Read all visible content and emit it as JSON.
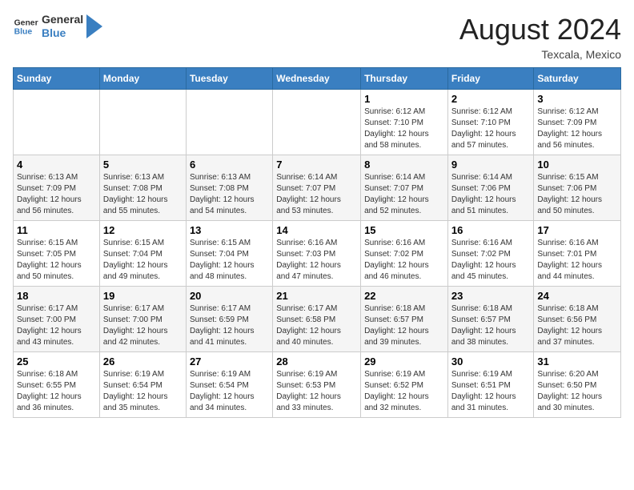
{
  "header": {
    "logo_line1": "General",
    "logo_line2": "Blue",
    "month_year": "August 2024",
    "location": "Texcala, Mexico"
  },
  "days_of_week": [
    "Sunday",
    "Monday",
    "Tuesday",
    "Wednesday",
    "Thursday",
    "Friday",
    "Saturday"
  ],
  "weeks": [
    [
      {
        "day": "",
        "info": ""
      },
      {
        "day": "",
        "info": ""
      },
      {
        "day": "",
        "info": ""
      },
      {
        "day": "",
        "info": ""
      },
      {
        "day": "1",
        "info": "Sunrise: 6:12 AM\nSunset: 7:10 PM\nDaylight: 12 hours\nand 58 minutes."
      },
      {
        "day": "2",
        "info": "Sunrise: 6:12 AM\nSunset: 7:10 PM\nDaylight: 12 hours\nand 57 minutes."
      },
      {
        "day": "3",
        "info": "Sunrise: 6:12 AM\nSunset: 7:09 PM\nDaylight: 12 hours\nand 56 minutes."
      }
    ],
    [
      {
        "day": "4",
        "info": "Sunrise: 6:13 AM\nSunset: 7:09 PM\nDaylight: 12 hours\nand 56 minutes."
      },
      {
        "day": "5",
        "info": "Sunrise: 6:13 AM\nSunset: 7:08 PM\nDaylight: 12 hours\nand 55 minutes."
      },
      {
        "day": "6",
        "info": "Sunrise: 6:13 AM\nSunset: 7:08 PM\nDaylight: 12 hours\nand 54 minutes."
      },
      {
        "day": "7",
        "info": "Sunrise: 6:14 AM\nSunset: 7:07 PM\nDaylight: 12 hours\nand 53 minutes."
      },
      {
        "day": "8",
        "info": "Sunrise: 6:14 AM\nSunset: 7:07 PM\nDaylight: 12 hours\nand 52 minutes."
      },
      {
        "day": "9",
        "info": "Sunrise: 6:14 AM\nSunset: 7:06 PM\nDaylight: 12 hours\nand 51 minutes."
      },
      {
        "day": "10",
        "info": "Sunrise: 6:15 AM\nSunset: 7:06 PM\nDaylight: 12 hours\nand 50 minutes."
      }
    ],
    [
      {
        "day": "11",
        "info": "Sunrise: 6:15 AM\nSunset: 7:05 PM\nDaylight: 12 hours\nand 50 minutes."
      },
      {
        "day": "12",
        "info": "Sunrise: 6:15 AM\nSunset: 7:04 PM\nDaylight: 12 hours\nand 49 minutes."
      },
      {
        "day": "13",
        "info": "Sunrise: 6:15 AM\nSunset: 7:04 PM\nDaylight: 12 hours\nand 48 minutes."
      },
      {
        "day": "14",
        "info": "Sunrise: 6:16 AM\nSunset: 7:03 PM\nDaylight: 12 hours\nand 47 minutes."
      },
      {
        "day": "15",
        "info": "Sunrise: 6:16 AM\nSunset: 7:02 PM\nDaylight: 12 hours\nand 46 minutes."
      },
      {
        "day": "16",
        "info": "Sunrise: 6:16 AM\nSunset: 7:02 PM\nDaylight: 12 hours\nand 45 minutes."
      },
      {
        "day": "17",
        "info": "Sunrise: 6:16 AM\nSunset: 7:01 PM\nDaylight: 12 hours\nand 44 minutes."
      }
    ],
    [
      {
        "day": "18",
        "info": "Sunrise: 6:17 AM\nSunset: 7:00 PM\nDaylight: 12 hours\nand 43 minutes."
      },
      {
        "day": "19",
        "info": "Sunrise: 6:17 AM\nSunset: 7:00 PM\nDaylight: 12 hours\nand 42 minutes."
      },
      {
        "day": "20",
        "info": "Sunrise: 6:17 AM\nSunset: 6:59 PM\nDaylight: 12 hours\nand 41 minutes."
      },
      {
        "day": "21",
        "info": "Sunrise: 6:17 AM\nSunset: 6:58 PM\nDaylight: 12 hours\nand 40 minutes."
      },
      {
        "day": "22",
        "info": "Sunrise: 6:18 AM\nSunset: 6:57 PM\nDaylight: 12 hours\nand 39 minutes."
      },
      {
        "day": "23",
        "info": "Sunrise: 6:18 AM\nSunset: 6:57 PM\nDaylight: 12 hours\nand 38 minutes."
      },
      {
        "day": "24",
        "info": "Sunrise: 6:18 AM\nSunset: 6:56 PM\nDaylight: 12 hours\nand 37 minutes."
      }
    ],
    [
      {
        "day": "25",
        "info": "Sunrise: 6:18 AM\nSunset: 6:55 PM\nDaylight: 12 hours\nand 36 minutes."
      },
      {
        "day": "26",
        "info": "Sunrise: 6:19 AM\nSunset: 6:54 PM\nDaylight: 12 hours\nand 35 minutes."
      },
      {
        "day": "27",
        "info": "Sunrise: 6:19 AM\nSunset: 6:54 PM\nDaylight: 12 hours\nand 34 minutes."
      },
      {
        "day": "28",
        "info": "Sunrise: 6:19 AM\nSunset: 6:53 PM\nDaylight: 12 hours\nand 33 minutes."
      },
      {
        "day": "29",
        "info": "Sunrise: 6:19 AM\nSunset: 6:52 PM\nDaylight: 12 hours\nand 32 minutes."
      },
      {
        "day": "30",
        "info": "Sunrise: 6:19 AM\nSunset: 6:51 PM\nDaylight: 12 hours\nand 31 minutes."
      },
      {
        "day": "31",
        "info": "Sunrise: 6:20 AM\nSunset: 6:50 PM\nDaylight: 12 hours\nand 30 minutes."
      }
    ]
  ]
}
